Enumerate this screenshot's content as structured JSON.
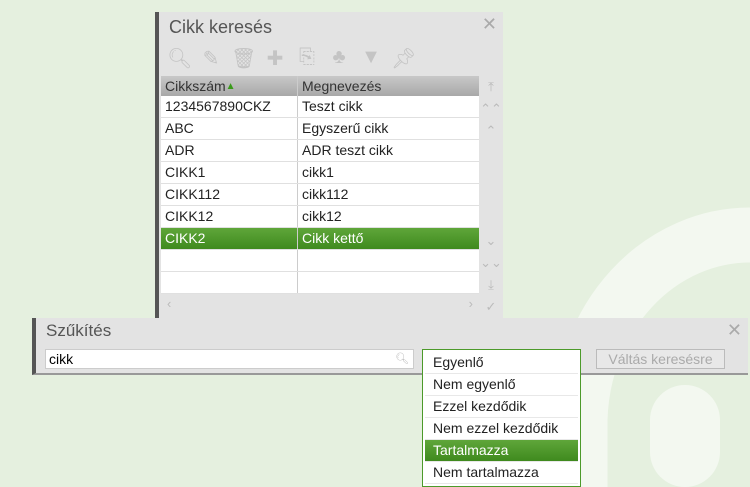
{
  "search_dialog": {
    "title": "Cikk keresés",
    "toolbar": [
      "search-icon",
      "edit-icon",
      "delete-icon",
      "add-icon",
      "copy-icon",
      "tree-icon",
      "filter-icon",
      "pin-icon"
    ],
    "columns": [
      "Cikkszám",
      "Megnevezés"
    ],
    "rows": [
      [
        "1234567890CKZ",
        "Teszt cikk"
      ],
      [
        "ABC",
        "Egyszerű cikk"
      ],
      [
        "ADR",
        "ADR teszt cikk"
      ],
      [
        "CIKK1",
        "cikk1"
      ],
      [
        "CIKK112",
        "cikk112"
      ],
      [
        "CIKK12",
        "cikk12"
      ],
      [
        "CIKK2",
        "Cikk kettő"
      ],
      [
        "",
        ""
      ],
      [
        "",
        ""
      ]
    ],
    "selected_row": 6
  },
  "filter_panel": {
    "title": "Szűkítés",
    "input_value": "cikk",
    "switch_button": "Váltás keresésre",
    "operator_options": [
      "Egyenlő",
      "Nem egyenlő",
      "Ezzel kezdődik",
      "Nem ezzel kezdődik",
      "Tartalmazza",
      "Nem tartalmazza"
    ],
    "selected_option": 4
  },
  "colors": {
    "accent": "#4c9a2a"
  }
}
